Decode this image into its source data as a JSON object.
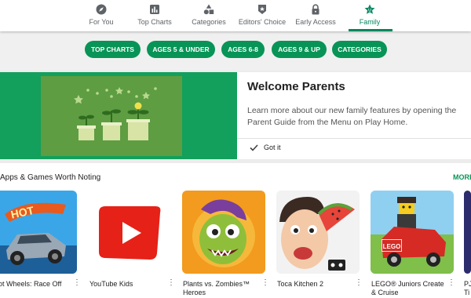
{
  "tabs": [
    {
      "label": "For You",
      "icon": "compass-icon"
    },
    {
      "label": "Top Charts",
      "icon": "bar-chart-icon"
    },
    {
      "label": "Categories",
      "icon": "shapes-icon"
    },
    {
      "label": "Editors' Choice",
      "icon": "badge-icon"
    },
    {
      "label": "Early Access",
      "icon": "lock-icon"
    },
    {
      "label": "Family",
      "icon": "star-face-icon"
    }
  ],
  "chips": [
    "TOP CHARTS",
    "AGES 5 & UNDER",
    "AGES 6-8",
    "AGES 9 & UP",
    "CATEGORIES"
  ],
  "welcome": {
    "title": "Welcome Parents",
    "body": "Learn more about our new family features by opening the Parent Guide from the Menu on Play Home.",
    "gotit": "Got it"
  },
  "section": {
    "title": "Apps & Games Worth Noting",
    "more": "MORE"
  },
  "apps": [
    {
      "name_line1": "ot Wheels: Race Off",
      "name_line2": ""
    },
    {
      "name_line1": "YouTube Kids",
      "name_line2": ""
    },
    {
      "name_line1": "Plants vs. Zombies™",
      "name_line2": "Heroes"
    },
    {
      "name_line1": "Toca Kitchen 2",
      "name_line2": ""
    },
    {
      "name_line1": "LEGO® Juniors Create",
      "name_line2": "& Cruise"
    },
    {
      "name_line1": "PJ",
      "name_line2": "Ti"
    }
  ],
  "overflow_icon": "⋮",
  "colors": {
    "accent": "#01875f",
    "chip": "#089456",
    "promo": "#12a05c"
  }
}
